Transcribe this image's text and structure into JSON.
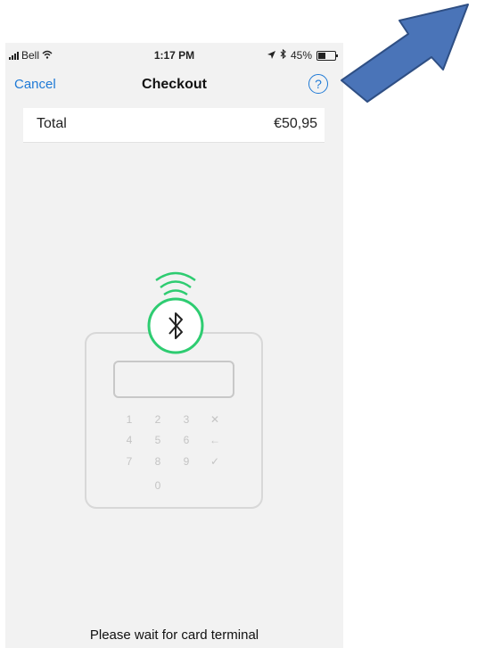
{
  "status_bar": {
    "carrier": "Bell",
    "time": "1:17 PM",
    "battery_text": "45%",
    "battery_level": 0.45,
    "icons": [
      "signal-icon",
      "wifi-icon",
      "location-icon",
      "bluetooth-icon",
      "battery-icon"
    ]
  },
  "nav": {
    "cancel_label": "Cancel",
    "title": "Checkout",
    "help_label": "?",
    "accent_color": "#1f7ad6"
  },
  "total": {
    "label": "Total",
    "value": "€50,95"
  },
  "terminal": {
    "bluetooth_color": "#2ecc71",
    "keypad": [
      [
        "1",
        "2",
        "3",
        "✕"
      ],
      [
        "4",
        "5",
        "6",
        "←"
      ],
      [
        "7",
        "8",
        "9",
        "✓"
      ],
      [
        "",
        "0",
        "",
        ""
      ]
    ]
  },
  "message": "Please wait for card terminal",
  "annotation": {
    "arrow_color": "#4a74b8"
  }
}
